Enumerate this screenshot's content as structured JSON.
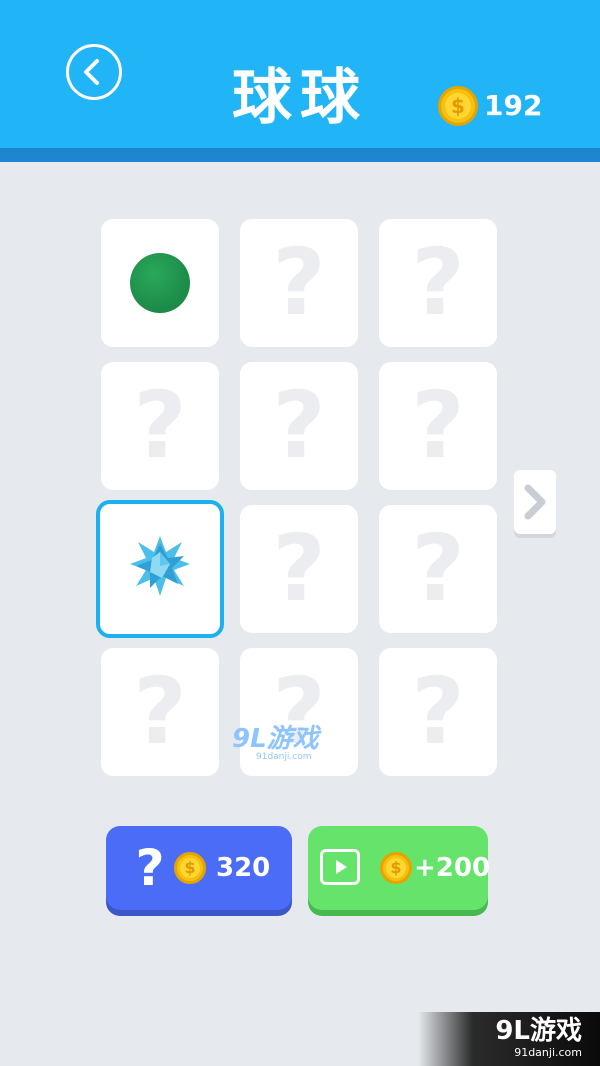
{
  "header": {
    "title": "球球",
    "back_icon": "chevron-left-icon",
    "coin_symbol": "$",
    "coin_count": "192"
  },
  "grid": {
    "question_mark": "?",
    "tiles": [
      {
        "state": "unlocked",
        "content": "green-ball"
      },
      {
        "state": "locked"
      },
      {
        "state": "locked"
      },
      {
        "state": "locked"
      },
      {
        "state": "locked"
      },
      {
        "state": "locked"
      },
      {
        "state": "selected",
        "content": "blue-star-ball"
      },
      {
        "state": "locked"
      },
      {
        "state": "locked"
      },
      {
        "state": "locked"
      },
      {
        "state": "locked"
      },
      {
        "state": "locked"
      }
    ]
  },
  "next_page_icon": "chevron-right-icon",
  "buttons": {
    "unlock_random": {
      "symbol": "?",
      "coin_symbol": "$",
      "cost": "320"
    },
    "watch_video": {
      "icon": "play-video-icon",
      "coin_symbol": "$",
      "reward": "+200"
    }
  },
  "watermarks": {
    "center_logo": "9L游戏",
    "center_site": "91danji.com",
    "corner_logo": "9L游戏",
    "corner_site": "91danji.com"
  },
  "colors": {
    "header_blue": "#21b5f7",
    "selected_border": "#1eb0ee",
    "button_blue": "#4b6cf7",
    "button_green": "#65e36b",
    "coin_gold": "#f4c20d"
  }
}
